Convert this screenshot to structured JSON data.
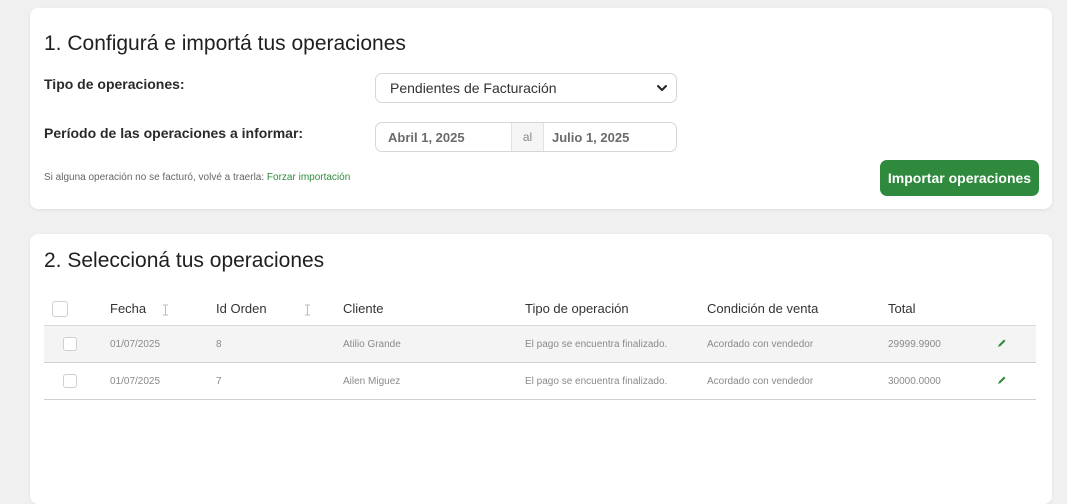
{
  "config": {
    "title": "1. Configurá e importá tus operaciones",
    "tipo_label": "Tipo de operaciones:",
    "tipo_value": "Pendientes de Facturación",
    "periodo_label": "Período de las operaciones a informar:",
    "date_from": "Abril 1, 2025",
    "date_sep": "al",
    "date_to": "Julio 1, 2025",
    "hint_text": "Si alguna operación no se facturó, volvé a traerla: ",
    "hint_link": "Forzar importación",
    "import_button": "Importar operaciones"
  },
  "select": {
    "title": "2. Seleccioná tus operaciones",
    "columns": {
      "fecha": "Fecha",
      "id_orden": "Id Orden",
      "cliente": "Cliente",
      "tipo": "Tipo de operación",
      "condicion": "Condición de venta",
      "total": "Total"
    },
    "rows": [
      {
        "fecha": "01/07/2025",
        "id": "8",
        "cliente": "Atilio Grande",
        "tipo": "El pago se encuentra finalizado.",
        "condicion": "Acordado con vendedor",
        "total": "29999.9900"
      },
      {
        "fecha": "01/07/2025",
        "id": "7",
        "cliente": "Ailen Miguez",
        "tipo": "El pago se encuentra finalizado.",
        "condicion": "Acordado con vendedor",
        "total": "30000.0000"
      }
    ]
  },
  "colors": {
    "accent": "#2f8a3e",
    "link": "#2e8b3d"
  },
  "icons": [
    "chevron-down-icon",
    "sort-icon",
    "pencil-icon",
    "checkbox"
  ]
}
